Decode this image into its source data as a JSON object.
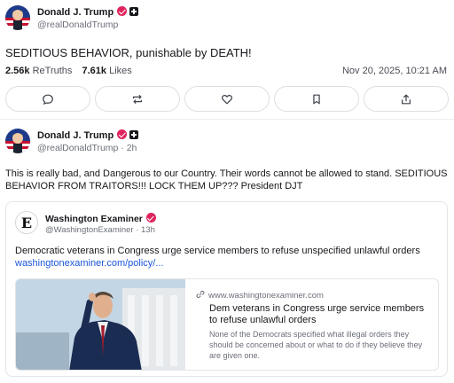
{
  "post1": {
    "author_name": "Donald J. Trump",
    "author_handle": "@realDonaldTrump",
    "text": "SEDITIOUS BEHAVIOR, punishable by DEATH!",
    "retruths_count": "2.56k",
    "retruths_label": "ReTruths",
    "likes_count": "7.61k",
    "likes_label": "Likes",
    "timestamp": "Nov 20, 2025, 10:21 AM"
  },
  "actions": [
    {
      "icon": "reply-icon"
    },
    {
      "icon": "retruth-icon"
    },
    {
      "icon": "like-icon"
    },
    {
      "icon": "bookmark-icon"
    },
    {
      "icon": "share-icon"
    }
  ],
  "post2": {
    "author_name": "Donald J. Trump",
    "author_handle": "@realDonaldTrump · 2h",
    "text": "This is really bad, and Dangerous to our Country. Their words cannot be allowed to stand. SEDITIOUS BEHAVIOR FROM TRAITORS!!! LOCK THEM UP??? President DJT",
    "quoted": {
      "name": "Washington Examiner",
      "handle": "@WashingtonExaminer · 13h",
      "text": "Democratic veterans in Congress urge service members to refuse unspecified unlawful orders",
      "link": "washingtonexaminer.com/policy/...",
      "preview": {
        "domain": "www.washingtonexaminer.com",
        "title": "Dem veterans in Congress urge service members to refuse unlawful orders",
        "description": "None of the Democrats specified what illegal orders they should be concerned about or what to do if they believe they are given one."
      }
    }
  },
  "colors": {
    "verified_badge": "#e0245e",
    "link": "#1a56db",
    "muted_text": "#6b6f78"
  }
}
